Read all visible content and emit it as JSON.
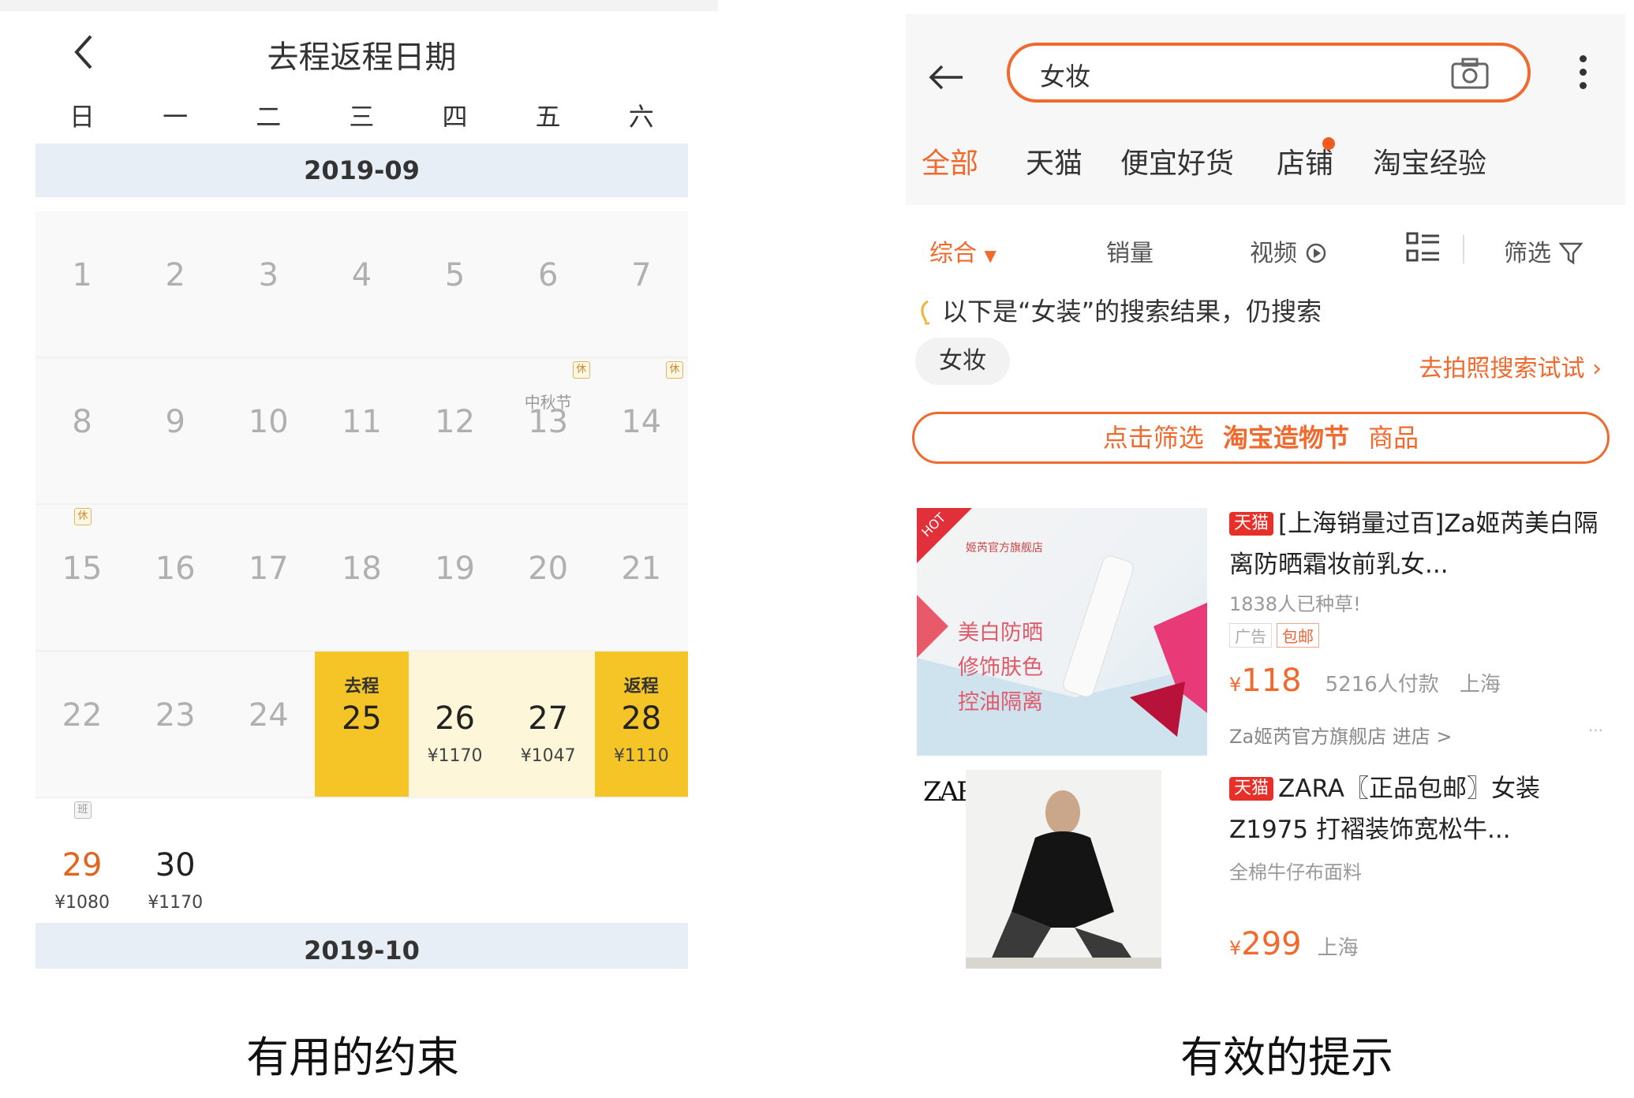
{
  "calendar": {
    "title": "去程返程日期",
    "weekdays": [
      "日",
      "一",
      "二",
      "三",
      "四",
      "五",
      "六"
    ],
    "month1": "2019-09",
    "month2": "2019-10",
    "rest_mark": "休",
    "work_mark": "班",
    "festival": "中秋节",
    "depart_label": "去程",
    "return_label": "返程",
    "days": {
      "d1": "1",
      "d2": "2",
      "d3": "3",
      "d4": "4",
      "d5": "5",
      "d6": "6",
      "d7": "7",
      "d8": "8",
      "d9": "9",
      "d10": "10",
      "d11": "11",
      "d12": "12",
      "d13": "13",
      "d14": "14",
      "d15": "15",
      "d16": "16",
      "d17": "17",
      "d18": "18",
      "d19": "19",
      "d20": "20",
      "d21": "21",
      "d22": "22",
      "d23": "23",
      "d24": "24",
      "d25": "25",
      "d26": "26",
      "d27": "27",
      "d28": "28",
      "d29": "29",
      "d30": "30"
    },
    "prices": {
      "p26": "¥1170",
      "p27": "¥1047",
      "p28": "¥1110",
      "p29": "¥1080",
      "p30": "¥1170"
    },
    "colors": {
      "selected": "#f5c427",
      "range": "#fdf6d8",
      "sunday": "#e0651f"
    }
  },
  "search": {
    "query": "女妆",
    "tabs": [
      "全部",
      "天猫",
      "便宜好货",
      "店铺",
      "淘宝经验"
    ],
    "sort": {
      "overall": "综合",
      "sales": "销量",
      "video": "视频",
      "filter": "筛选"
    },
    "hint_text": "以下是“女装”的搜索结果，仍搜索",
    "hint_chip": "女妆",
    "photo_link": "去拍照搜索试试",
    "banner_pre": "点击筛选",
    "banner_bold": "淘宝造物节",
    "banner_post": "商品",
    "accent": "#f06a2e",
    "products": [
      {
        "tmall": "天猫",
        "title": "[上海销量过百]Za姬芮美白隔离防晒霜妆前乳女...",
        "sub": "1838人已种草!",
        "badge1": "广告",
        "badge2": "包邮",
        "yen": "¥",
        "price": "118",
        "sold": "5216人付款",
        "location": "上海",
        "store": "Za姬芮官方旗舰店 进店 >",
        "img_text1": "美白防晒",
        "img_text2": "修饰肤色",
        "img_text3": "控油隔离",
        "img_hot": "HOT",
        "img_store": "姬芮官方旗舰店"
      },
      {
        "tmall": "天猫",
        "title": "ZARA〖正品包邮〗女装 Z1975 打褶装饰宽松牛...",
        "sub": "全棉牛仔布面料",
        "yen": "¥",
        "price": "299",
        "location": "上海",
        "img_logo": "ZARA"
      }
    ]
  },
  "captions": {
    "left": "有用的约束",
    "right": "有效的提示"
  }
}
